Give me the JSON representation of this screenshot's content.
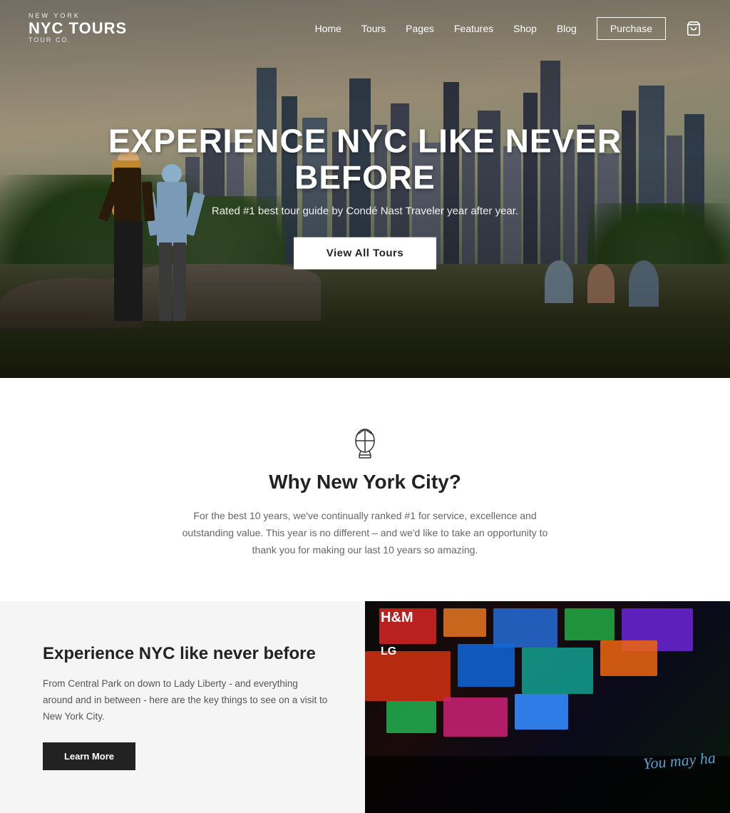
{
  "logo": {
    "top": "NEW YORK",
    "main": "NYC TOURS",
    "sub": "TOUR CO."
  },
  "nav": {
    "links": [
      {
        "label": "Home",
        "id": "home"
      },
      {
        "label": "Tours",
        "id": "tours"
      },
      {
        "label": "Pages",
        "id": "pages"
      },
      {
        "label": "Features",
        "id": "features"
      },
      {
        "label": "Shop",
        "id": "shop"
      },
      {
        "label": "Blog",
        "id": "blog"
      }
    ],
    "purchase_label": "Purchase",
    "cart_icon": "🛍"
  },
  "hero": {
    "title": "EXPERIENCE NYC LIKE NEVER BEFORE",
    "subtitle": "Rated #1 best tour guide by Condé Nast Traveler year after year.",
    "cta_label": "View All Tours"
  },
  "why": {
    "icon": "balloon",
    "title": "Why New York City?",
    "text": "For the best 10 years, we've continually ranked #1 for service, excellence and outstanding value. This year is no different – and we'd like to take an opportunity to thank you for making our last 10 years so amazing."
  },
  "experience": {
    "title": "Experience NYC like never before",
    "text": "From Central Park on down to Lady Liberty - and everything around and in between - here are the key things to see on a visit to New York City.",
    "cta_label": "Learn More"
  }
}
